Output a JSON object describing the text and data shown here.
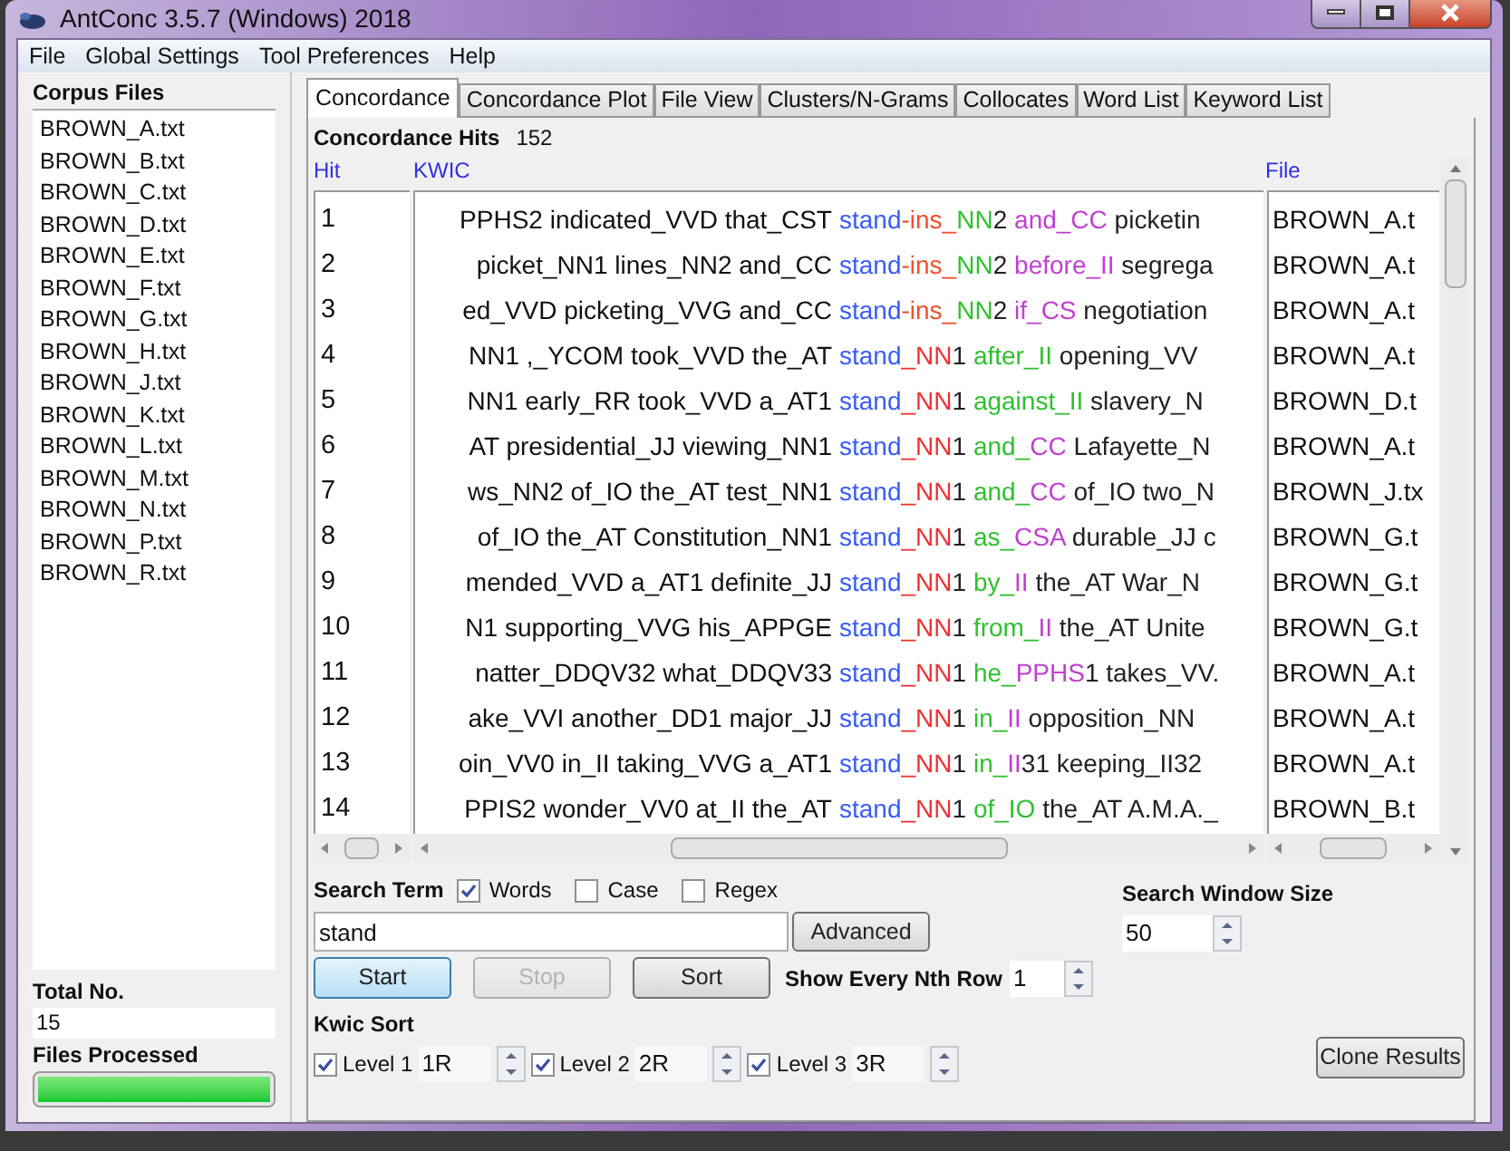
{
  "window": {
    "title": "AntConc 3.5.7 (Windows) 2018"
  },
  "menu": [
    "File",
    "Global Settings",
    "Tool Preferences",
    "Help"
  ],
  "corpus_files": {
    "title": "Corpus Files",
    "items": [
      "BROWN_A.txt",
      "BROWN_B.txt",
      "BROWN_C.txt",
      "BROWN_D.txt",
      "BROWN_E.txt",
      "BROWN_F.txt",
      "BROWN_G.txt",
      "BROWN_H.txt",
      "BROWN_J.txt",
      "BROWN_K.txt",
      "BROWN_L.txt",
      "BROWN_M.txt",
      "BROWN_N.txt",
      "BROWN_P.txt",
      "BROWN_R.txt"
    ]
  },
  "total": {
    "label": "Total No.",
    "value": "15"
  },
  "files_processed": {
    "label": "Files Processed",
    "level": 1
  },
  "tabs": [
    {
      "label": "Concordance",
      "selected": true
    },
    {
      "label": "Concordance Plot",
      "selected": false
    },
    {
      "label": "File View",
      "selected": false
    },
    {
      "label": "Clusters/N-Grams",
      "selected": false
    },
    {
      "label": "Collocates",
      "selected": false
    },
    {
      "label": "Word List",
      "selected": false
    },
    {
      "label": "Keyword List",
      "selected": false
    }
  ],
  "hits": {
    "label": "Concordance Hits",
    "value": "152"
  },
  "table": {
    "columns": [
      "Hit",
      "KWIC",
      "File"
    ],
    "rows": [
      {
        "hit": "1",
        "left": "PPHS2 indicated_VVD that_CST",
        "right": [
          {
            "text": "stand",
            "color": "#3b5cf5"
          },
          {
            "text": "-ins_",
            "color": "#f0502d"
          },
          {
            "text": "NN",
            "color": "#30c030"
          },
          {
            "text": "2 ",
            "color": "#222222"
          },
          {
            "text": "and_CC",
            "color": "#c040d0"
          },
          {
            "text": " picketin",
            "color": "#222222"
          }
        ],
        "file": "BROWN_A.t"
      },
      {
        "hit": "2",
        "left": "picket_NN1 lines_NN2 and_CC",
        "right": [
          {
            "text": "stand",
            "color": "#3b5cf5"
          },
          {
            "text": "-ins_",
            "color": "#f0502d"
          },
          {
            "text": "NN",
            "color": "#30c030"
          },
          {
            "text": "2 ",
            "color": "#222222"
          },
          {
            "text": "before_II",
            "color": "#c040d0"
          },
          {
            "text": " segrega",
            "color": "#222222"
          }
        ],
        "file": "BROWN_A.t"
      },
      {
        "hit": "3",
        "left": "ed_VVD picketing_VVG and_CC",
        "right": [
          {
            "text": "stand",
            "color": "#3b5cf5"
          },
          {
            "text": "-ins_",
            "color": "#f0502d"
          },
          {
            "text": "NN",
            "color": "#30c030"
          },
          {
            "text": "2 ",
            "color": "#222222"
          },
          {
            "text": "if_CS",
            "color": "#c040d0"
          },
          {
            "text": " negotiation",
            "color": "#222222"
          }
        ],
        "file": "BROWN_A.t"
      },
      {
        "hit": "4",
        "left": "NN1 ,_YCOM took_VVD the_AT",
        "right": [
          {
            "text": "stand",
            "color": "#3b5cf5"
          },
          {
            "text": "_NN",
            "color": "#f03030"
          },
          {
            "text": "1 ",
            "color": "#222222"
          },
          {
            "text": "after_II",
            "color": "#30c030"
          },
          {
            "text": " opening_VV",
            "color": "#222222"
          }
        ],
        "file": "BROWN_A.t"
      },
      {
        "hit": "5",
        "left": "NN1 early_RR took_VVD a_AT1",
        "right": [
          {
            "text": "stand",
            "color": "#3b5cf5"
          },
          {
            "text": "_NN",
            "color": "#f03030"
          },
          {
            "text": "1 ",
            "color": "#222222"
          },
          {
            "text": "against_II",
            "color": "#30c030"
          },
          {
            "text": " slavery_N",
            "color": "#222222"
          }
        ],
        "file": "BROWN_D.t"
      },
      {
        "hit": "6",
        "left": "AT presidential_JJ viewing_NN1",
        "right": [
          {
            "text": "stand",
            "color": "#3b5cf5"
          },
          {
            "text": "_NN",
            "color": "#f03030"
          },
          {
            "text": "1 ",
            "color": "#222222"
          },
          {
            "text": "and_",
            "color": "#30c030"
          },
          {
            "text": "CC",
            "color": "#c040d0"
          },
          {
            "text": " Lafayette_N",
            "color": "#222222"
          }
        ],
        "file": "BROWN_A.t"
      },
      {
        "hit": "7",
        "left": "ws_NN2 of_IO the_AT test_NN1",
        "right": [
          {
            "text": "stand",
            "color": "#3b5cf5"
          },
          {
            "text": "_NN",
            "color": "#f03030"
          },
          {
            "text": "1 ",
            "color": "#222222"
          },
          {
            "text": "and_",
            "color": "#30c030"
          },
          {
            "text": "CC",
            "color": "#c040d0"
          },
          {
            "text": " of_IO two_N",
            "color": "#222222"
          }
        ],
        "file": "BROWN_J.tx"
      },
      {
        "hit": "8",
        "left": "of_IO the_AT Constitution_NN1",
        "right": [
          {
            "text": "stand",
            "color": "#3b5cf5"
          },
          {
            "text": "_NN",
            "color": "#f03030"
          },
          {
            "text": "1 ",
            "color": "#222222"
          },
          {
            "text": "as_",
            "color": "#30c030"
          },
          {
            "text": "CSA",
            "color": "#c040d0"
          },
          {
            "text": " durable_JJ c",
            "color": "#222222"
          }
        ],
        "file": "BROWN_G.t"
      },
      {
        "hit": "9",
        "left": "mended_VVD a_AT1 definite_JJ",
        "right": [
          {
            "text": "stand",
            "color": "#3b5cf5"
          },
          {
            "text": "_NN",
            "color": "#f03030"
          },
          {
            "text": "1 ",
            "color": "#222222"
          },
          {
            "text": "by_",
            "color": "#30c030"
          },
          {
            "text": "II",
            "color": "#c040d0"
          },
          {
            "text": " the_AT War_N",
            "color": "#222222"
          }
        ],
        "file": "BROWN_G.t"
      },
      {
        "hit": "10",
        "left": "N1 supporting_VVG his_APPGE",
        "right": [
          {
            "text": "stand",
            "color": "#3b5cf5"
          },
          {
            "text": "_NN",
            "color": "#f03030"
          },
          {
            "text": "1 ",
            "color": "#222222"
          },
          {
            "text": "from_",
            "color": "#30c030"
          },
          {
            "text": "II",
            "color": "#c040d0"
          },
          {
            "text": " the_AT Unite",
            "color": "#222222"
          }
        ],
        "file": "BROWN_G.t"
      },
      {
        "hit": "11",
        "left": "natter_DDQV32 what_DDQV33",
        "right": [
          {
            "text": "stand",
            "color": "#3b5cf5"
          },
          {
            "text": "_NN",
            "color": "#f03030"
          },
          {
            "text": "1 ",
            "color": "#222222"
          },
          {
            "text": "he_",
            "color": "#30c030"
          },
          {
            "text": "PPHS",
            "color": "#c040d0"
          },
          {
            "text": "1 takes_VV.",
            "color": "#222222"
          }
        ],
        "file": "BROWN_A.t"
      },
      {
        "hit": "12",
        "left": "ake_VVI another_DD1 major_JJ",
        "right": [
          {
            "text": "stand",
            "color": "#3b5cf5"
          },
          {
            "text": "_NN",
            "color": "#f03030"
          },
          {
            "text": "1 ",
            "color": "#222222"
          },
          {
            "text": "in_",
            "color": "#30c030"
          },
          {
            "text": "II",
            "color": "#c040d0"
          },
          {
            "text": " opposition_NN",
            "color": "#222222"
          }
        ],
        "file": "BROWN_A.t"
      },
      {
        "hit": "13",
        "left": "oin_VV0 in_II taking_VVG a_AT1",
        "right": [
          {
            "text": "stand",
            "color": "#3b5cf5"
          },
          {
            "text": "_NN",
            "color": "#f03030"
          },
          {
            "text": "1 ",
            "color": "#222222"
          },
          {
            "text": "in_",
            "color": "#30c030"
          },
          {
            "text": "II",
            "color": "#c040d0"
          },
          {
            "text": "31 keeping_II32",
            "color": "#222222"
          }
        ],
        "file": "BROWN_A.t"
      },
      {
        "hit": "14",
        "left": "PPIS2 wonder_VV0 at_II the_AT",
        "right": [
          {
            "text": "stand",
            "color": "#3b5cf5"
          },
          {
            "text": "_NN",
            "color": "#f03030"
          },
          {
            "text": "1 ",
            "color": "#222222"
          },
          {
            "text": "of_IO",
            "color": "#30c030"
          },
          {
            "text": " the_AT A.M.A._",
            "color": "#222222"
          }
        ],
        "file": "BROWN_B.t"
      }
    ]
  },
  "search": {
    "label": "Search Term",
    "options": [
      {
        "label": "Words",
        "checked": true
      },
      {
        "label": "Case",
        "checked": false
      },
      {
        "label": "Regex",
        "checked": false
      }
    ],
    "value": "stand",
    "advanced": "Advanced"
  },
  "window_size": {
    "label": "Search Window Size",
    "value": "50"
  },
  "buttons": [
    {
      "label": "Start",
      "kind": "default",
      "disabled": false
    },
    {
      "label": "Stop",
      "kind": "normal",
      "disabled": true
    },
    {
      "label": "Sort",
      "kind": "normal",
      "disabled": false
    }
  ],
  "nth_row": {
    "label": "Show Every Nth Row",
    "value": "1"
  },
  "kwic_sort": {
    "label": "Kwic Sort",
    "levels": [
      {
        "label": "Level 1",
        "checked": true,
        "value": "1R"
      },
      {
        "label": "Level 2",
        "checked": true,
        "value": "2R"
      },
      {
        "label": "Level 3",
        "checked": true,
        "value": "3R"
      }
    ]
  },
  "clone": "Clone Results"
}
